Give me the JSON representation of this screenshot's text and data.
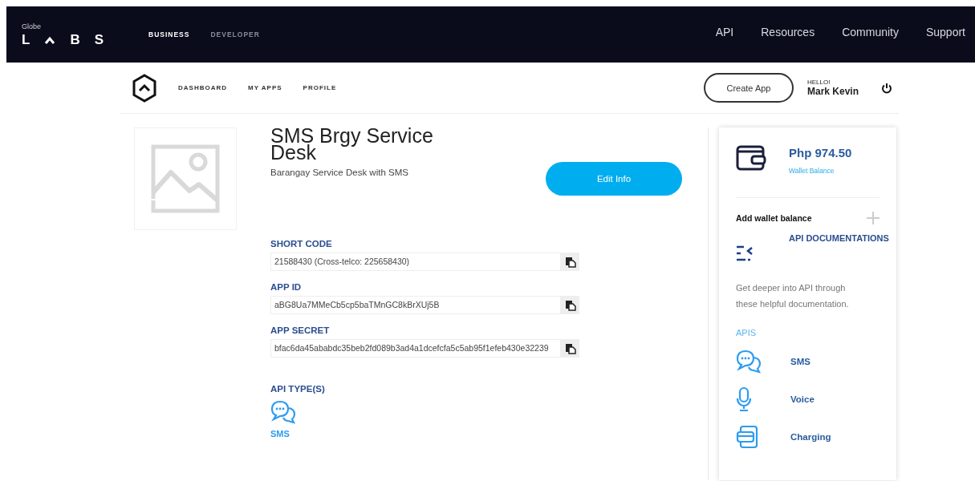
{
  "topbar": {
    "brand_small": "Globe",
    "brand_letters": [
      "L",
      "B",
      "S"
    ],
    "tabs": [
      {
        "label": "BUSINESS",
        "selected": true
      },
      {
        "label": "DEVELOPER",
        "selected": false
      }
    ],
    "links": [
      "API",
      "Resources",
      "Community",
      "Support"
    ]
  },
  "subnav": {
    "items": [
      "DASHBOARD",
      "MY APPS",
      "PROFILE"
    ],
    "create_button": "Create App",
    "greeting": "HELLO!",
    "user": "Mark Kevin"
  },
  "app": {
    "title": "SMS Brgy Service Desk",
    "description": "Barangay Service Desk with SMS",
    "edit_button": "Edit Info",
    "fields": [
      {
        "label": "SHORT CODE",
        "value": "21588430 (Cross-telco: 225658430)"
      },
      {
        "label": "APP ID",
        "value": "aBG8Ua7MMeCb5cp5baTMnGC8kBrXUj5B"
      },
      {
        "label": "APP SECRET",
        "value": "bfac6da45ababdc35beb2fd089b3ad4a1dcefcfa5c5ab95f1efeb430e32239"
      }
    ],
    "api_types_label": "API TYPE(S)",
    "api_types": [
      {
        "kind": "sms",
        "label": "SMS"
      }
    ]
  },
  "sidebar": {
    "balance": "Php 974.50",
    "balance_label": "Wallet Balance",
    "add_balance": "Add wallet balance",
    "docs_title": "API DOCUMENTATIONS",
    "docs_text": "Get deeper into API through these helpful documentation.",
    "apis_label": "APIS",
    "apis": [
      {
        "kind": "sms",
        "label": "SMS"
      },
      {
        "kind": "voice",
        "label": "Voice"
      },
      {
        "kind": "charging",
        "label": "Charging"
      }
    ]
  }
}
